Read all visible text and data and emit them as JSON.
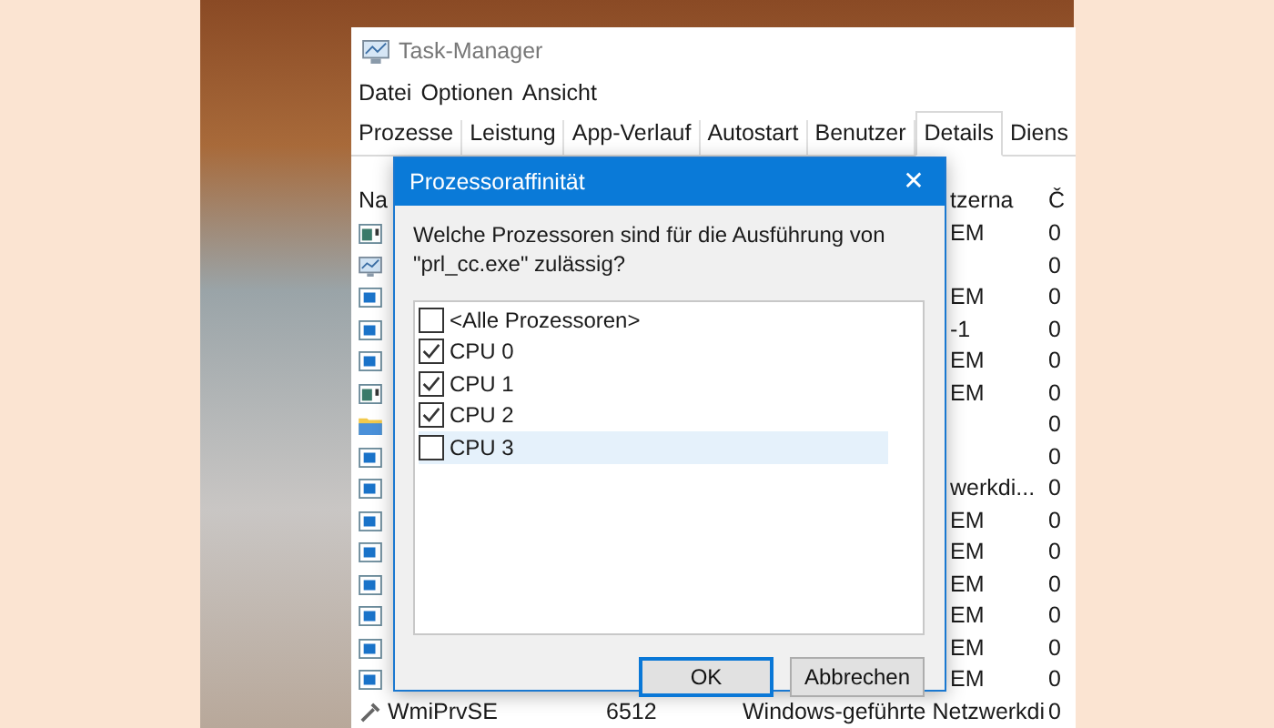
{
  "window": {
    "title": "Task-Manager"
  },
  "menu": [
    "Datei",
    "Optionen",
    "Ansicht"
  ],
  "tabs": [
    {
      "label": "Prozesse",
      "selected": false
    },
    {
      "label": "Leistung",
      "selected": false
    },
    {
      "label": "App-Verlauf",
      "selected": false
    },
    {
      "label": "Autostart",
      "selected": false
    },
    {
      "label": "Benutzer",
      "selected": false
    },
    {
      "label": "Details",
      "selected": true
    },
    {
      "label": "Diens",
      "selected": false
    }
  ],
  "table": {
    "columns": {
      "name": "Na",
      "user": "tzerna",
      "cpu": "Č"
    },
    "rows": [
      {
        "kind": "app",
        "user": "EM",
        "cpu": "0"
      },
      {
        "kind": "monitor",
        "cpu": "0"
      },
      {
        "kind": "service",
        "user": "EM",
        "cpu": "0"
      },
      {
        "kind": "service",
        "user": "-1",
        "cpu": "0"
      },
      {
        "kind": "service",
        "user": "EM",
        "cpu": "0"
      },
      {
        "kind": "app",
        "user": "EM",
        "cpu": "0"
      },
      {
        "kind": "folder",
        "cpu": "0"
      },
      {
        "kind": "service",
        "cpu": "0"
      },
      {
        "kind": "service",
        "user": "werkdi...",
        "cpu": "0"
      },
      {
        "kind": "service",
        "user": "EM",
        "cpu": "0"
      },
      {
        "kind": "service",
        "user": "EM",
        "cpu": "0"
      },
      {
        "kind": "service",
        "user": "EM",
        "cpu": "0"
      },
      {
        "kind": "service",
        "user": "EM",
        "cpu": "0"
      },
      {
        "kind": "service",
        "user": "EM",
        "cpu": "0"
      },
      {
        "kind": "service",
        "user": "EM",
        "cpu": "0"
      },
      {
        "kind": "tool",
        "name": "WmiPrvSE",
        "pid": "6512",
        "description": "Windows-geführte Netzwerkdi",
        "cpu": "0"
      }
    ]
  },
  "dialog": {
    "title": "Prozessoraffinität",
    "close": "✕",
    "prompt": "Welche Prozessoren sind für die Ausführung von \"prl_cc.exe\" zulässig?",
    "items": [
      {
        "label": "<Alle Prozessoren>",
        "checked": false,
        "selected": false
      },
      {
        "label": "CPU 0",
        "checked": true,
        "selected": false
      },
      {
        "label": "CPU 1",
        "checked": true,
        "selected": false
      },
      {
        "label": "CPU 2",
        "checked": true,
        "selected": false
      },
      {
        "label": "CPU 3",
        "checked": false,
        "selected": true
      }
    ],
    "buttons": [
      {
        "label": "OK",
        "default": true
      },
      {
        "label": "Abbrechen",
        "default": false
      }
    ]
  }
}
